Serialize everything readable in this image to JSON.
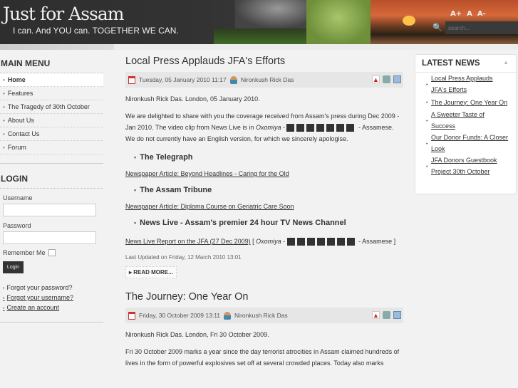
{
  "header": {
    "title": "Just for Assam",
    "tagline": "I can. And YOU can. TOGETHER WE CAN.",
    "font_controls": [
      "A+",
      "A",
      "A-"
    ],
    "search_placeholder": "search..."
  },
  "main_menu": {
    "title": "MAIN MENU",
    "items": [
      "Home",
      "Features",
      "The Tragedy of 30th October",
      "About Us",
      "Contact Us",
      "Forum"
    ]
  },
  "login": {
    "title": "LOGIN",
    "username_label": "Username",
    "password_label": "Password",
    "remember_label": "Remember Me",
    "button": "Login",
    "links": [
      "Forgot your password?",
      "Forgot your username?",
      "Create an account"
    ]
  },
  "articles": [
    {
      "title": "Local Press Applauds JFA's Efforts",
      "date": "Tuesday, 05 January 2010 11:17",
      "author": "Nironkush Rick Das",
      "intro": "Nironkush Rick Das. London, 05 January 2010.",
      "p1a": "We are delighted to share with you the coverage received from Assam's press during Dec 2009 - Jan 2010. The video clip from News Live is in ",
      "p1_italic": "Oxomiya",
      "p1b": " - Assamese. We do not currently have an English version, for which we sincerely apologise.",
      "sections": [
        {
          "heading": "The Telegraph",
          "link": "Newspaper Article: Beyond Headlines - Caring for the Old"
        },
        {
          "heading": "The Assam Tribune",
          "link": "Newspaper Article: Diploma Course on Geriatric Care Soon"
        },
        {
          "heading": "News Live - Assam's premier 24 hour TV News Channel",
          "link": "News Live Report on the JFA (27 Dec 2009)"
        }
      ],
      "link_suffix_a": " [ ",
      "link_suffix_italic": "Oxomiya",
      "link_suffix_b": " - Assamese ]",
      "updated": "Last Updated on Friday, 12 March 2010 13:01",
      "read_more": "READ MORE..."
    },
    {
      "title": "The Journey: One Year On",
      "date": "Friday, 30 October 2009 13:11",
      "author": "Nironkush Rick Das",
      "intro": "Nironkush Rick Das. London, Fri 30 October 2009.",
      "p1": "Fri 30 October 2009 marks a year since the day terrorist atrocities in Assam claimed hundreds of lives in the form of powerful explosives set off at several crowded places. Today also marks"
    }
  ],
  "latest_news": {
    "title": "LATEST NEWS",
    "items": [
      "Local Press Applauds JFA's Efforts",
      "The Journey: One Year On",
      "A Sweeter Taste of Success",
      "Our Donor Funds: A Closer Look",
      "JFA Donors Guestbook Project 30th October"
    ]
  }
}
